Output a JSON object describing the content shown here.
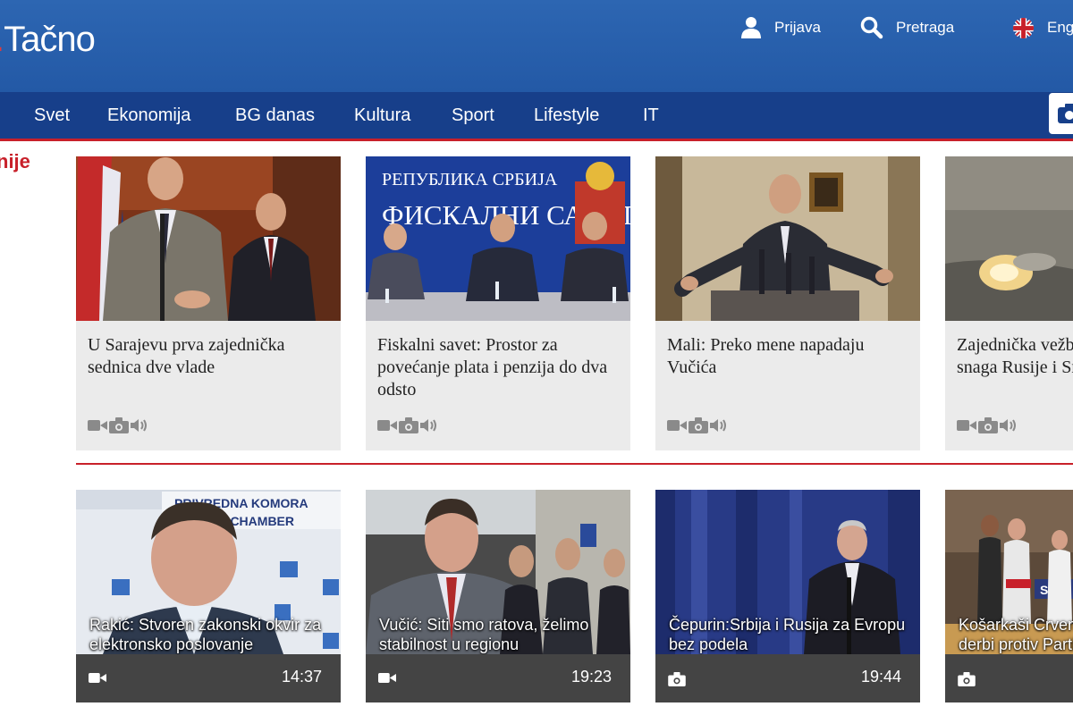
{
  "header": {
    "logo_main": "Tačno",
    "logo_dot": ".",
    "login": "Prijava",
    "search": "Pretraga",
    "language": "Eng"
  },
  "nav": {
    "items": [
      {
        "label": "Svet"
      },
      {
        "label": "Ekonomija"
      },
      {
        "label": "BG danas"
      },
      {
        "label": "Kultura"
      },
      {
        "label": "Sport"
      },
      {
        "label": "Lifestyle"
      },
      {
        "label": "IT"
      }
    ]
  },
  "section": {
    "title": "nije"
  },
  "news": [
    {
      "title": "U Sarajevu prva zajednička sednica dve vlade",
      "photo_text": ""
    },
    {
      "title": "Fiskalni savet: Prostor za povećanje plata i penzija do dva odsto",
      "photo_text": "РЕПУБЛИКА СРБИЈА",
      "photo_text2": "ФИСКАЛНИ САВЕТ"
    },
    {
      "title": "Mali: Preko mene napadaju Vučića",
      "photo_text": ""
    },
    {
      "title": "Zajednička vežba vazdušnih snaga Rusije i Srbije",
      "photo_text": ""
    }
  ],
  "videos": [
    {
      "title": "Rakić: Stvoren zakonski okvir za elektronsko poslovanje",
      "time": "14:37",
      "type": "video",
      "photo_text": "PRIVREDNA KOMORA",
      "photo_text2": "GRADE CHAMBER"
    },
    {
      "title": "Vučić: Siti smo ratova, želimo stabilnost u regionu",
      "time": "19:23",
      "type": "video"
    },
    {
      "title": "Čepurin:Srbija i Rusija za Evropu bez podela",
      "time": "19:44",
      "type": "photo"
    },
    {
      "title": "Košarkaši Crvene zvezde dobili derbi protiv Partizana",
      "time": "",
      "type": "photo",
      "photo_text": "SIC"
    }
  ],
  "colors": {
    "header_blue": "#2d66b2",
    "nav_blue": "#173f8a",
    "accent_red": "#c8202a",
    "card_bg": "#ebebeb",
    "video_bg": "#444444"
  },
  "icons": {
    "login": "user-icon",
    "search": "search-icon",
    "language": "uk-flag-icon",
    "camera": "camera-icon",
    "video": "video-camera-icon",
    "audio": "speaker-icon"
  }
}
